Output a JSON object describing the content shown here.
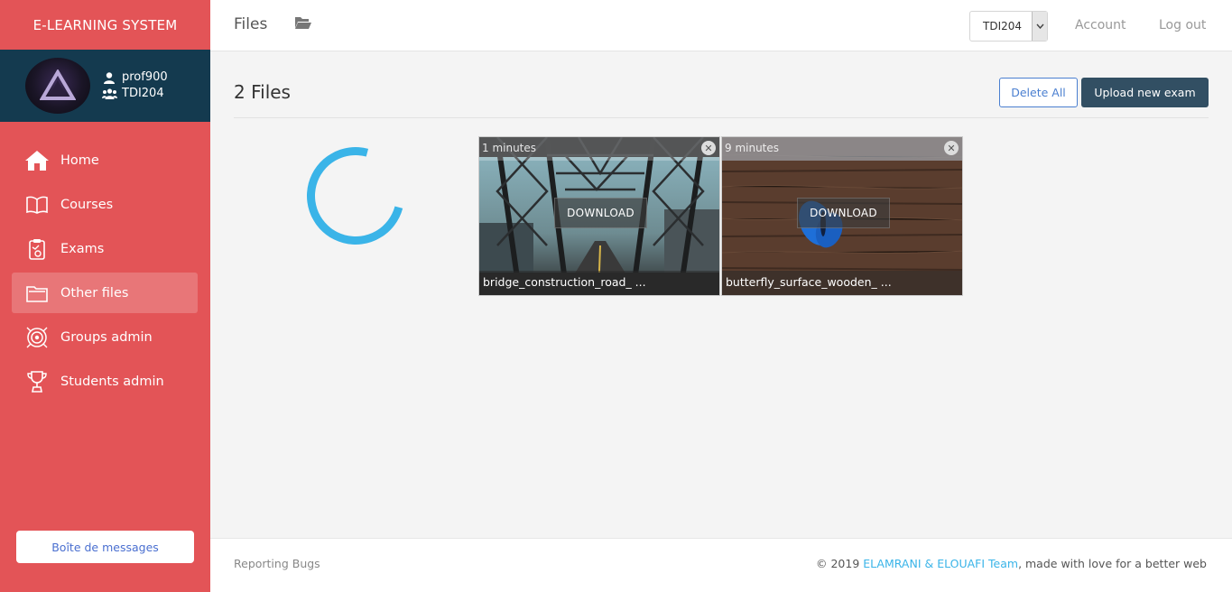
{
  "brand": "E-LEARNING SYSTEM",
  "profile": {
    "username": "prof900",
    "group": "TDI204"
  },
  "nav": [
    {
      "label": "Home",
      "icon": "home-icon"
    },
    {
      "label": "Courses",
      "icon": "book-icon"
    },
    {
      "label": "Exams",
      "icon": "exam-clipboard-icon"
    },
    {
      "label": "Other files",
      "icon": "folder-icon",
      "active": true
    },
    {
      "label": "Groups admin",
      "icon": "target-icon"
    },
    {
      "label": "Students admin",
      "icon": "trophy-icon"
    }
  ],
  "message_button": "Boîte de messages",
  "header": {
    "title": "Files",
    "group_select": "TDI204",
    "account": "Account",
    "logout": "Log out"
  },
  "page": {
    "heading": "2 Files",
    "delete_all": "Delete All",
    "upload": "Upload new exam"
  },
  "files": [
    {
      "time": "1 minutes",
      "download": "DOWNLOAD",
      "name": "bridge_construction_road_ ..."
    },
    {
      "time": "9 minutes",
      "download": "DOWNLOAD",
      "name": "butterfly_surface_wooden_ ..."
    }
  ],
  "footer": {
    "bugs": "Reporting Bugs",
    "copy_prefix": "© 2019 ",
    "team": "ELAMRANI & ELOUAFI Team",
    "copy_suffix": ", made with love for a better web"
  },
  "colors": {
    "sidebar": "#e35457",
    "profile_bg": "#143a4f",
    "upload_button": "#324f63",
    "spinner": "#3ab4e8"
  }
}
